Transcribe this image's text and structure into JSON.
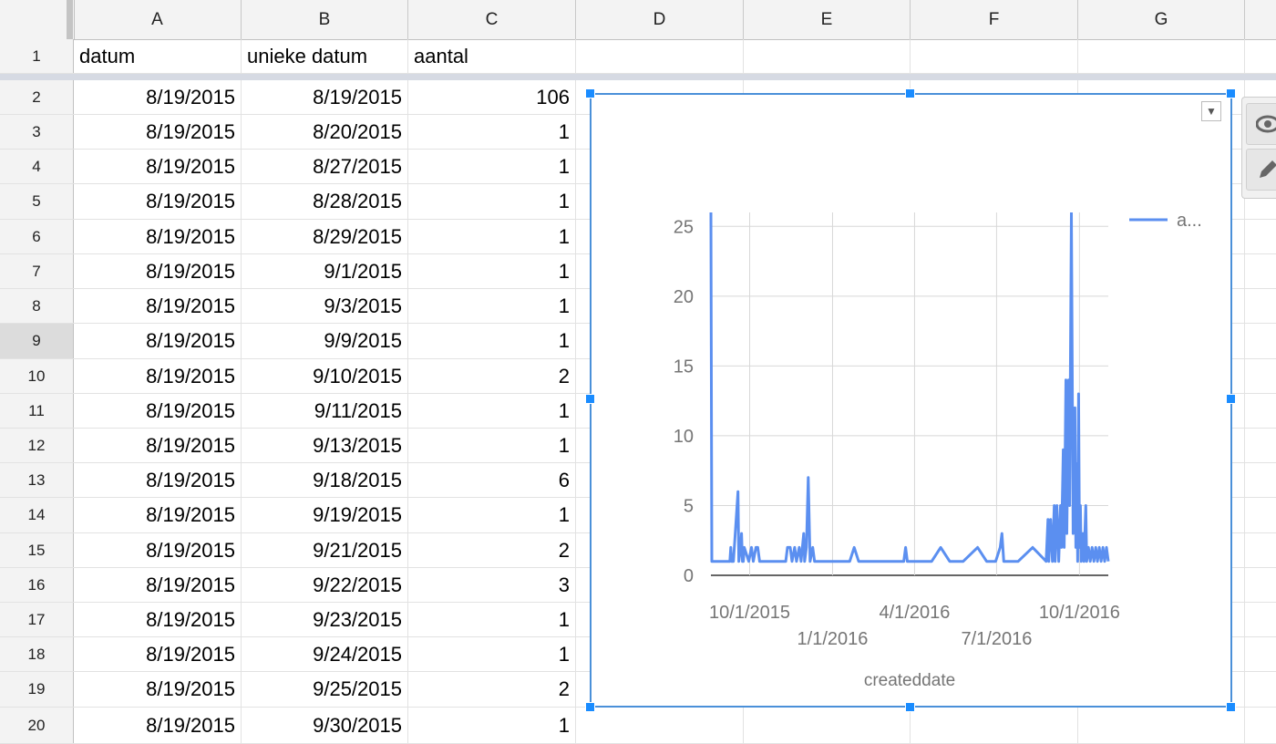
{
  "columns": [
    "A",
    "B",
    "C",
    "D",
    "E",
    "F",
    "G"
  ],
  "rows": [
    {
      "n": "1",
      "a": "datum",
      "b": "unieke datum",
      "c": "aantal"
    },
    {
      "n": "2",
      "a": "8/19/2015",
      "b": "8/19/2015",
      "c": "106"
    },
    {
      "n": "3",
      "a": "8/19/2015",
      "b": "8/20/2015",
      "c": "1"
    },
    {
      "n": "4",
      "a": "8/19/2015",
      "b": "8/27/2015",
      "c": "1"
    },
    {
      "n": "5",
      "a": "8/19/2015",
      "b": "8/28/2015",
      "c": "1"
    },
    {
      "n": "6",
      "a": "8/19/2015",
      "b": "8/29/2015",
      "c": "1"
    },
    {
      "n": "7",
      "a": "8/19/2015",
      "b": "9/1/2015",
      "c": "1"
    },
    {
      "n": "8",
      "a": "8/19/2015",
      "b": "9/3/2015",
      "c": "1"
    },
    {
      "n": "9",
      "a": "8/19/2015",
      "b": "9/9/2015",
      "c": "1"
    },
    {
      "n": "10",
      "a": "8/19/2015",
      "b": "9/10/2015",
      "c": "2"
    },
    {
      "n": "11",
      "a": "8/19/2015",
      "b": "9/11/2015",
      "c": "1"
    },
    {
      "n": "12",
      "a": "8/19/2015",
      "b": "9/13/2015",
      "c": "1"
    },
    {
      "n": "13",
      "a": "8/19/2015",
      "b": "9/18/2015",
      "c": "6"
    },
    {
      "n": "14",
      "a": "8/19/2015",
      "b": "9/19/2015",
      "c": "1"
    },
    {
      "n": "15",
      "a": "8/19/2015",
      "b": "9/21/2015",
      "c": "2"
    },
    {
      "n": "16",
      "a": "8/19/2015",
      "b": "9/22/2015",
      "c": "3"
    },
    {
      "n": "17",
      "a": "8/19/2015",
      "b": "9/23/2015",
      "c": "1"
    },
    {
      "n": "18",
      "a": "8/19/2015",
      "b": "9/24/2015",
      "c": "1"
    },
    {
      "n": "19",
      "a": "8/19/2015",
      "b": "9/25/2015",
      "c": "2"
    },
    {
      "n": "20",
      "a": "8/19/2015",
      "b": "9/30/2015",
      "c": "1"
    }
  ],
  "selected_row": "9",
  "chart_data": {
    "type": "line",
    "title": "",
    "xlabel": "createddate",
    "ylabel": "",
    "ylim": [
      0,
      26
    ],
    "y_ticks": [
      "0",
      "5",
      "10",
      "15",
      "20",
      "25"
    ],
    "x_ticks": [
      "10/1/2015",
      "1/1/2016",
      "4/1/2016",
      "7/1/2016",
      "10/1/2016"
    ],
    "legend": "top-right",
    "series": [
      {
        "name": "a...",
        "color": "#5b8ff0",
        "points": [
          [
            "2015-08-19",
            106
          ],
          [
            "2015-08-20",
            1
          ],
          [
            "2015-08-27",
            1
          ],
          [
            "2015-08-28",
            1
          ],
          [
            "2015-08-29",
            1
          ],
          [
            "2015-09-01",
            1
          ],
          [
            "2015-09-03",
            1
          ],
          [
            "2015-09-09",
            1
          ],
          [
            "2015-09-10",
            2
          ],
          [
            "2015-09-11",
            1
          ],
          [
            "2015-09-13",
            1
          ],
          [
            "2015-09-18",
            6
          ],
          [
            "2015-09-19",
            1
          ],
          [
            "2015-09-21",
            2
          ],
          [
            "2015-09-22",
            3
          ],
          [
            "2015-09-23",
            1
          ],
          [
            "2015-09-24",
            1
          ],
          [
            "2015-09-25",
            2
          ],
          [
            "2015-09-30",
            1
          ],
          [
            "2015-10-03",
            2
          ],
          [
            "2015-10-05",
            1
          ],
          [
            "2015-10-08",
            2
          ],
          [
            "2015-10-10",
            2
          ],
          [
            "2015-10-12",
            1
          ],
          [
            "2015-10-25",
            1
          ],
          [
            "2015-11-10",
            1
          ],
          [
            "2015-11-12",
            2
          ],
          [
            "2015-11-15",
            2
          ],
          [
            "2015-11-17",
            1
          ],
          [
            "2015-11-20",
            2
          ],
          [
            "2015-11-22",
            1
          ],
          [
            "2015-11-25",
            2
          ],
          [
            "2015-11-27",
            1
          ],
          [
            "2015-11-30",
            3
          ],
          [
            "2015-12-01",
            1
          ],
          [
            "2015-12-03",
            2
          ],
          [
            "2015-12-05",
            7
          ],
          [
            "2015-12-07",
            1
          ],
          [
            "2015-12-10",
            2
          ],
          [
            "2015-12-12",
            1
          ],
          [
            "2016-01-20",
            1
          ],
          [
            "2016-01-25",
            2
          ],
          [
            "2016-01-30",
            1
          ],
          [
            "2016-03-20",
            1
          ],
          [
            "2016-03-22",
            2
          ],
          [
            "2016-03-24",
            1
          ],
          [
            "2016-04-20",
            1
          ],
          [
            "2016-04-30",
            2
          ],
          [
            "2016-05-10",
            1
          ],
          [
            "2016-05-25",
            1
          ],
          [
            "2016-06-10",
            2
          ],
          [
            "2016-06-20",
            1
          ],
          [
            "2016-06-30",
            1
          ],
          [
            "2016-07-05",
            2
          ],
          [
            "2016-07-07",
            3
          ],
          [
            "2016-07-09",
            1
          ],
          [
            "2016-07-25",
            1
          ],
          [
            "2016-08-10",
            2
          ],
          [
            "2016-08-25",
            1
          ],
          [
            "2016-08-27",
            4
          ],
          [
            "2016-08-28",
            1
          ],
          [
            "2016-08-30",
            4
          ],
          [
            "2016-09-01",
            1
          ],
          [
            "2016-09-03",
            5
          ],
          [
            "2016-09-04",
            1
          ],
          [
            "2016-09-06",
            5
          ],
          [
            "2016-09-08",
            1
          ],
          [
            "2016-09-10",
            5
          ],
          [
            "2016-09-11",
            2
          ],
          [
            "2016-09-13",
            9
          ],
          [
            "2016-09-14",
            2
          ],
          [
            "2016-09-16",
            14
          ],
          [
            "2016-09-17",
            3
          ],
          [
            "2016-09-19",
            14
          ],
          [
            "2016-09-20",
            5
          ],
          [
            "2016-09-22",
            26
          ],
          [
            "2016-09-24",
            3
          ],
          [
            "2016-09-26",
            12
          ],
          [
            "2016-09-27",
            2
          ],
          [
            "2016-09-28",
            8
          ],
          [
            "2016-09-29",
            1
          ],
          [
            "2016-09-30",
            13
          ],
          [
            "2016-10-01",
            2
          ],
          [
            "2016-10-02",
            5
          ],
          [
            "2016-10-03",
            1
          ],
          [
            "2016-10-05",
            3
          ],
          [
            "2016-10-06",
            1
          ],
          [
            "2016-10-08",
            5
          ],
          [
            "2016-10-09",
            1
          ],
          [
            "2016-10-11",
            2
          ],
          [
            "2016-10-13",
            1
          ],
          [
            "2016-10-15",
            2
          ],
          [
            "2016-10-17",
            1
          ],
          [
            "2016-10-19",
            2
          ],
          [
            "2016-10-21",
            1
          ],
          [
            "2016-10-23",
            2
          ],
          [
            "2016-10-25",
            1
          ],
          [
            "2016-10-27",
            2
          ],
          [
            "2016-10-29",
            1
          ],
          [
            "2016-10-31",
            2
          ],
          [
            "2016-11-02",
            1
          ]
        ]
      }
    ]
  }
}
